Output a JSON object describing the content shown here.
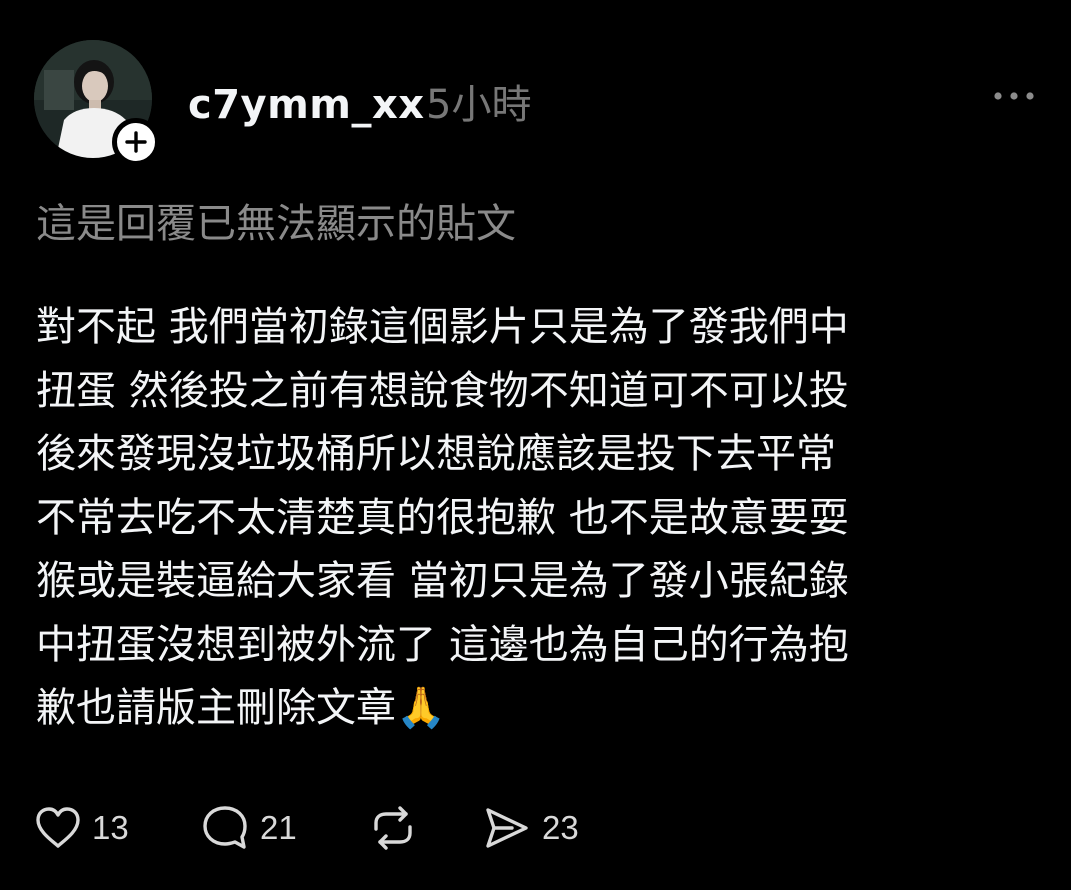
{
  "post": {
    "username": "c7ymm_xx",
    "time_ago": "5小時",
    "notice": "這是回覆已無法顯示的貼文",
    "body_lines": [
      "對不起 我們當初錄這個影片只是為了發我們中",
      "扭蛋 然後投之前有想說食物不知道可不可以投",
      "後來發現沒垃圾桶所以想說應該是投下去平常",
      "不常去吃不太清楚真的很抱歉 也不是故意要耍",
      "猴或是裝逼給大家看 當初只是為了發小張紀錄",
      "中扭蛋沒想到被外流了 這邊也為自己的行為抱",
      "歉也請版主刪除文章🙏"
    ],
    "actions": {
      "like_count": "13",
      "reply_count": "21",
      "share_count": "23"
    }
  },
  "icons": {
    "follow": "plus-icon",
    "more": "more-horizontal-icon",
    "like": "heart-icon",
    "reply": "comment-bubble-icon",
    "repost": "repost-icon",
    "share": "send-icon"
  },
  "colors": {
    "background": "#000000",
    "primary_text": "#f3f5f7",
    "secondary_text": "#777777",
    "notice_text": "#8a8a8a"
  }
}
